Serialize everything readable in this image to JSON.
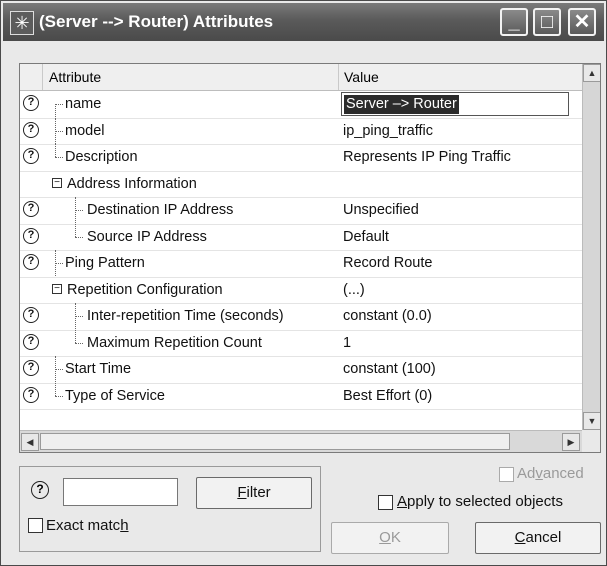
{
  "window": {
    "title": "(Server --> Router) Attributes",
    "app_icon": "✳",
    "buttons": {
      "minimize": "_",
      "maximize": "□",
      "close": "✕"
    }
  },
  "table": {
    "headers": {
      "attribute": "Attribute",
      "value": "Value"
    },
    "help_glyph": "?",
    "collapse_glyph": "−",
    "rows": [
      {
        "label": "name",
        "value": "Server –> Router"
      },
      {
        "label": "model",
        "value": "ip_ping_traffic"
      },
      {
        "label": "Description",
        "value": "Represents IP Ping Traffic"
      },
      {
        "label": "Address Information",
        "value": ""
      },
      {
        "label": "Destination IP Address",
        "value": "Unspecified"
      },
      {
        "label": "Source IP Address",
        "value": "Default"
      },
      {
        "label": "Ping Pattern",
        "value": "Record Route"
      },
      {
        "label": "Repetition Configuration",
        "value": "(...)"
      },
      {
        "label": "Inter-repetition Time (seconds)",
        "value": "constant (0.0)"
      },
      {
        "label": "Maximum Repetition Count",
        "value": "1"
      },
      {
        "label": "Start Time",
        "value": "constant (100)"
      },
      {
        "label": "Type of Service",
        "value": "Best Effort (0)"
      }
    ]
  },
  "scroll": {
    "up": "▲",
    "down": "▼",
    "left": "◀",
    "right": "▶"
  },
  "footer": {
    "help_glyph": "?",
    "filter_value": "",
    "filter_button": {
      "key": "F",
      "rest": "ilter"
    },
    "exact_match": {
      "pre": "Exact matc",
      "key": "h"
    },
    "advanced": {
      "pre": "Ad",
      "key": "v",
      "rest": "anced"
    },
    "apply_selected": {
      "key": "A",
      "rest": "pply to selected objects"
    },
    "ok_button": {
      "key": "O",
      "rest": "K"
    },
    "cancel_button": {
      "key": "C",
      "rest": "ancel"
    }
  }
}
